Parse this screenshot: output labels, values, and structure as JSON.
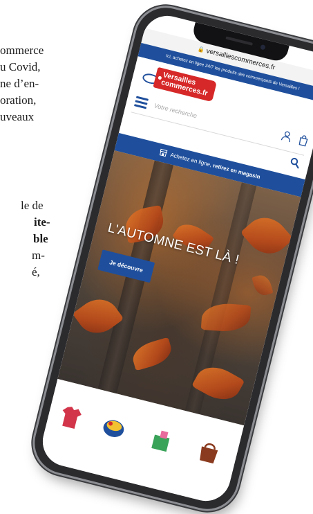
{
  "article": {
    "lines": [
      {
        "text": "ommerce",
        "bold": false
      },
      {
        "text": "u Covid,",
        "bold": false
      },
      {
        "text": "ne d’en-",
        "bold": false
      },
      {
        "text": "oration,",
        "bold": false
      },
      {
        "text": "uveaux",
        "bold": false
      },
      {
        "text": "le de",
        "bold": false
      },
      {
        "text": "ite-",
        "bold": true
      },
      {
        "text": "ble",
        "bold": true
      },
      {
        "text": "m-",
        "bold": false
      },
      {
        "text": "é,",
        "bold": false
      }
    ]
  },
  "browser": {
    "url": "versaillescommerces.fr"
  },
  "site": {
    "announcement": "Ici, achetez en ligne 24/7 les produits des commerçants de Versailles !",
    "logo": {
      "line1": "Versailles",
      "line2": "commerces.fr"
    },
    "search": {
      "placeholder": "Votre recherche"
    },
    "collect": {
      "prefix": "Achetez en ligne, ",
      "highlight": "retirez en magasin"
    },
    "hero": {
      "title": "L'AUTOMNE EST LÀ !",
      "button": "Je découvre"
    }
  },
  "colors": {
    "brand_blue": "#1f4f9c",
    "brand_red": "#d62828"
  },
  "icons": [
    "lock-icon",
    "menu-icon",
    "user-icon",
    "shopping-bag-icon",
    "search-icon",
    "store-icon"
  ]
}
